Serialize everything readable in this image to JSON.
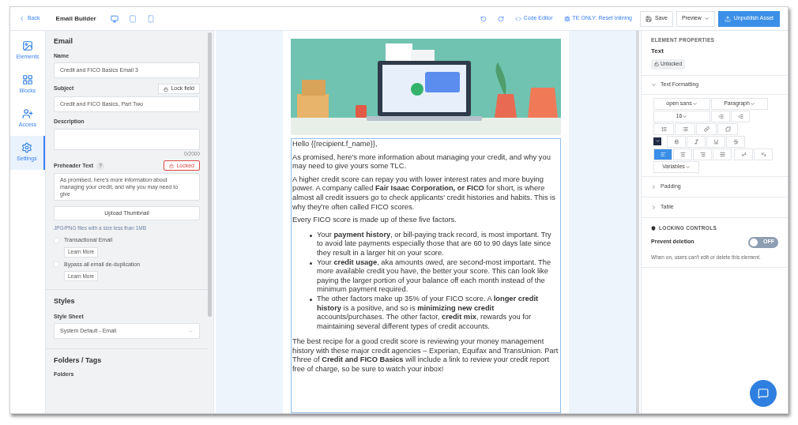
{
  "topbar": {
    "back": "Back",
    "title": "Email Builder",
    "devices": [
      {
        "kind": "desktop",
        "selected": true
      },
      {
        "kind": "tablet",
        "selected": false
      },
      {
        "kind": "phone",
        "selected": false
      }
    ],
    "actions": [
      {
        "kind": "undo"
      },
      {
        "kind": "redo"
      },
      {
        "kind": "code",
        "label": "Code Editor"
      },
      {
        "kind": "bug",
        "label": "TE ONLY: Reset Inlining"
      }
    ],
    "save": "Save",
    "preview": "Preview",
    "publish": "Unpublish Asset"
  },
  "rail": [
    {
      "kind": "elements",
      "label": "Elements",
      "selected": false
    },
    {
      "kind": "blocks",
      "label": "Blocks",
      "selected": false
    },
    {
      "kind": "access",
      "label": "Access",
      "selected": false
    },
    {
      "kind": "settings",
      "label": "Settings",
      "selected": true
    }
  ],
  "settings": {
    "title": "Email",
    "name": {
      "label": "Name",
      "value": "Credit and FICO Basics Email 3"
    },
    "subject": {
      "label": "Subject",
      "lock_button": "Lock field",
      "value": "Credit and FICO Basics, Part Two"
    },
    "description": {
      "label": "Description",
      "counter": "0/2000"
    },
    "preheader": {
      "label": "Preheader Text",
      "help": "?",
      "locked_button": "Locked",
      "value": "As promised, here's more information about managing your credit, and why you may need to give"
    },
    "upload_button": "Upload Thumbnail",
    "upload_hint": "JPG/PNG files with a size less than 1MB",
    "options": [
      {
        "label": "Transactional Email",
        "checked": false,
        "button": "Learn More"
      },
      {
        "label": "Bypass all email de-duplication",
        "checked": false,
        "button": "Learn More"
      }
    ],
    "styles": {
      "title": "Styles",
      "label": "Style Sheet",
      "value": "System Default - Email"
    },
    "folders": {
      "title": "Folders / Tags",
      "label": "Folders"
    }
  },
  "email": {
    "image": {
      "kind": "picture"
    },
    "greeting": "Hello {{recipient.f_name}},",
    "paragraphs": [
      "As promised, here's more information about managing your credit, and why you may need to give yours some TLC.",
      "A higher credit score can repay you with lower interest rates and more buying power. A company called **Fair Isaac Corporation, or FICO** for short, is where almost all credit issuers go to check applicants' credit histories and habits. This is why they're often called FICO scores.",
      "Every FICO score is made up of these five factors."
    ],
    "bullets": [
      "Your **payment history**, or bill-paying track record, is most important. Try to avoid late payments especially those that are 60 to 90 days late since they result in a larger hit on your score.",
      "Your **credit usage**, aka amounts owed, are second-most important. The more available credit you have, the better your score. This can look like paying the larger portion of your balance off each month instead of the minimum payment required.",
      "The other factors make up 35% of your FICO score. A **longer credit history** is a positive, and so is **minimizing new credit** accounts/purchases. The other factor, **credit mix**, rewards you for maintaining several different types of credit accounts."
    ],
    "closing": "The best recipe for a good credit score is reviewing your money management history with these major credit agencies – Experian, Equifax and TransUnion. Part Three of **Credit and FICO Basics** will include a link to review your credit report free of charge, so be sure to watch your inbox!"
  },
  "properties": {
    "heading": "ELEMENT PROPERTIES",
    "type": "Text",
    "lock_badge": "Unlocked",
    "formatting": {
      "title": "Text Formatting",
      "expanded": true,
      "font": "open sans",
      "block": "Paragraph",
      "size": "16",
      "variables": "Variables",
      "align": [
        {
          "kind": "left",
          "selected": true
        },
        {
          "kind": "center",
          "selected": false
        },
        {
          "kind": "right",
          "selected": false
        },
        {
          "kind": "justify",
          "selected": false
        }
      ]
    },
    "sections": [
      {
        "title": "Padding",
        "expanded": false
      },
      {
        "title": "Table",
        "expanded": false
      }
    ],
    "locking": {
      "title": "LOCKING CONTROLS",
      "label": "Prevent deletion",
      "on": false,
      "toggle_text": "OFF",
      "hint": "When on, users can't edit or delete this element."
    }
  }
}
